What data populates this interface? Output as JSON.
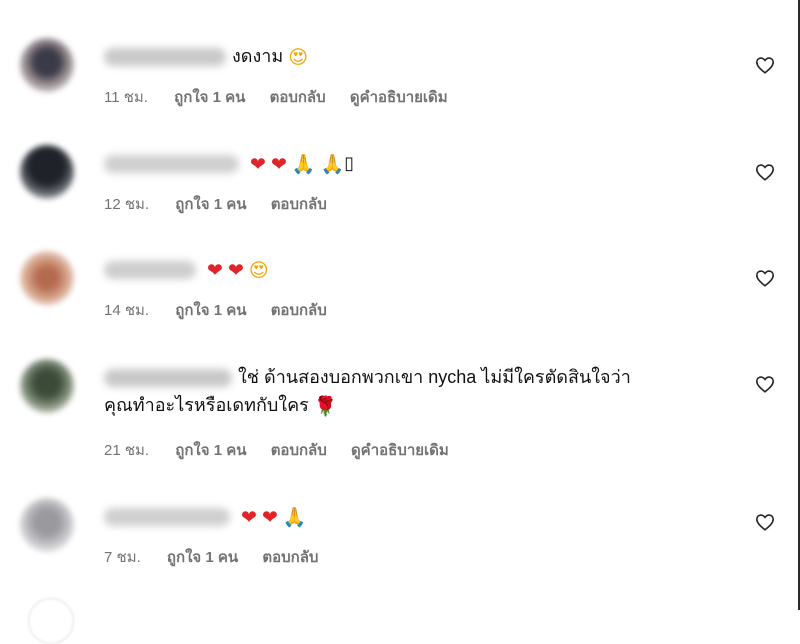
{
  "comments": [
    {
      "text": "งดงาม",
      "emojis": [
        "😍"
      ],
      "time": "11 ชม.",
      "likes": "ถูกใจ 1 คน",
      "reply": "ตอบกลับ",
      "translate": "ดูคำอธิบายเดิม"
    },
    {
      "text": "",
      "emojis": [
        "❤",
        "❤",
        "🙏",
        "🙏"
      ],
      "trailing": "▯",
      "time": "12 ชม.",
      "likes": "ถูกใจ 1 คน",
      "reply": "ตอบกลับ"
    },
    {
      "text": "",
      "emojis": [
        "❤",
        "❤",
        "😍"
      ],
      "time": "14 ชม.",
      "likes": "ถูกใจ 1 คน",
      "reply": "ตอบกลับ"
    },
    {
      "text_line1": "ใช่ ด้านสองบอกพวกเขา nycha ไม่มีใครตัดสินใจว่า",
      "text_line2": "คุณทำอะไรหรือเดทกับใคร",
      "emojis": [
        "🌹"
      ],
      "time": "21 ชม.",
      "likes": "ถูกใจ 1 คน",
      "reply": "ตอบกลับ",
      "translate": "ดูคำอธิบายเดิม"
    },
    {
      "text": "",
      "emojis": [
        "❤",
        "❤",
        "🙏"
      ],
      "time": "7 ชม.",
      "likes": "ถูกใจ 1 คน",
      "reply": "ตอบกลับ"
    }
  ],
  "icons": {
    "like": "heart-outline-icon",
    "avatar": "blurred-avatar"
  },
  "colors": {
    "meta_text": "#737373",
    "heart_emoji": "#e0242a"
  }
}
